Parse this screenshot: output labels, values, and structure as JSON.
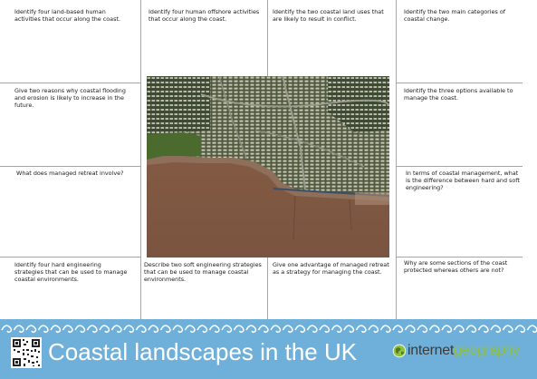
{
  "questions": [
    "Identify four land-based human activities that occur along the coast.",
    "Identify four human offshore activities that occur along the coast.",
    "Identify the two coastal land uses that are likely to result in conflict.",
    "Identify the two main categories of coastal change.",
    "Give two reasons why coastal flooding and erosion is likely to increase in the future.",
    "Identify the three options available to manage the coast.",
    "What does managed retreat involve?",
    "In terms of coastal management, what is the difference between hard and soft engineering?",
    "Identify four hard engineering strategies that can be used to manage coastal environments.",
    "Describe two soft engineering strategies that can be used to manage coastal environments.",
    "Give one advantage of managed retreat as a strategy for managing the coast.",
    "Why are some sections of the coast protected whereas others are not?"
  ],
  "footer": {
    "title": "Coastal landscapes in the UK",
    "brand_part1": "internet",
    "brand_part2": "geography"
  },
  "colors": {
    "footer_bg": "#6fb0da",
    "grid_line": "#7db3d6",
    "brand_green": "#8fc13e"
  },
  "icons": [
    "qr-code-icon",
    "globe-icon",
    "wave-pattern"
  ]
}
